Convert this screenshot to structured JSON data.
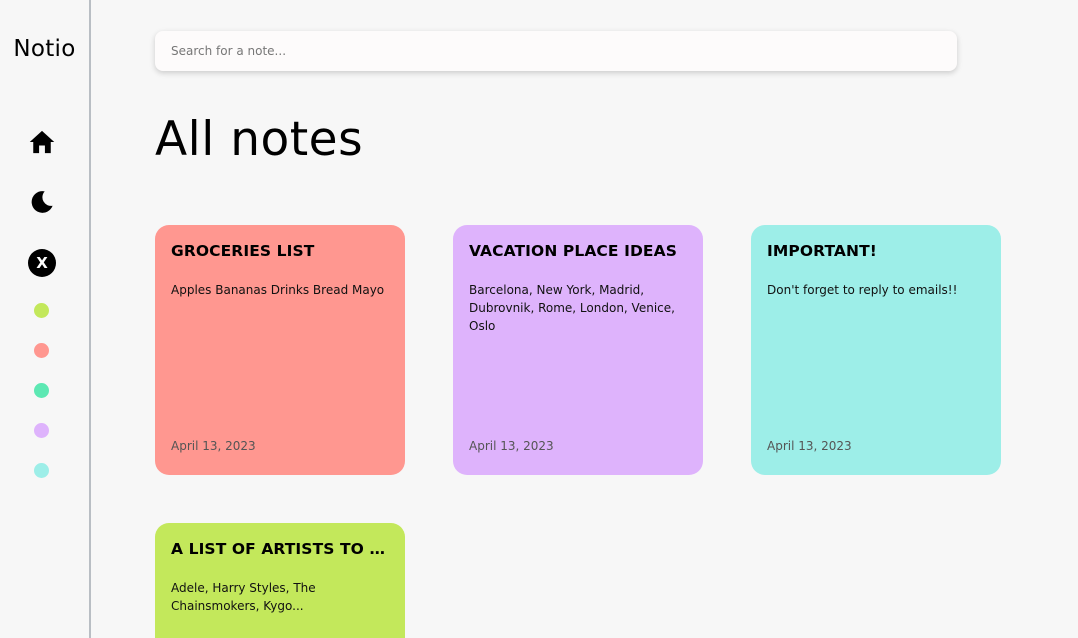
{
  "app": {
    "logo": "Notio"
  },
  "sidebar": {
    "icons": [
      "home-icon",
      "moon-icon",
      "close-icon"
    ],
    "close_glyph": "X",
    "color_dots": [
      "#c3e85b",
      "#ff9790",
      "#5de8b3",
      "#deb3fc",
      "#9deee8"
    ]
  },
  "search": {
    "placeholder": "Search for a note...",
    "value": ""
  },
  "page": {
    "title": "All notes"
  },
  "notes": [
    {
      "title": "GROCERIES LIST",
      "body": "Apples Bananas Drinks Bread Mayo",
      "date": "April 13, 2023",
      "color": "#ff9790"
    },
    {
      "title": "VACATION PLACE IDEAS",
      "body": "Barcelona, New York, Madrid, Dubrovnik, Rome, London, Venice, Oslo",
      "date": "April 13, 2023",
      "color": "#deb3fc"
    },
    {
      "title": "IMPORTANT!",
      "body": "Don't forget to reply to emails!!",
      "date": "April 13, 2023",
      "color": "#9deee8"
    },
    {
      "title": "A LIST OF ARTISTS TO LIS...",
      "body": "Adele, Harry Styles, The Chainsmokers, Kygo...",
      "date": "",
      "color": "#c3e85b"
    }
  ]
}
